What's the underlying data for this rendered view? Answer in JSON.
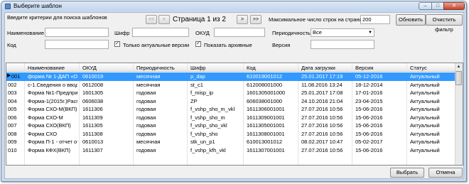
{
  "window": {
    "title": "Выберите шаблон",
    "min": "–",
    "max": "□",
    "close": "✕"
  },
  "toolbar": {
    "hint": "Введите критерии для поиска шаблонов",
    "first": "<<",
    "prev": "<",
    "page": "Страница 1 из 2",
    "next": ">",
    "last": ">>",
    "max_rows_label": "Максимальное число строк на странице",
    "max_rows_value": "200",
    "refresh": "Обновить",
    "clear_filter": "Очистить фильтр"
  },
  "filters": {
    "name_label": "Наименование",
    "cipher_label": "Шифр",
    "okud_label": "ОКУД",
    "period_label": "Периодичность",
    "period_value": "Все",
    "code_label": "Код",
    "only_actual_label": "Только актуальные версии",
    "show_archived_label": "Показать архивные",
    "version_label": "Версия"
  },
  "table": {
    "columns": [
      "Наименование",
      "ОКУД",
      "Периодичность",
      "Шифр",
      "Код",
      "Дата загрузки",
      "Версия",
      "Статус"
    ],
    "rows": [
      {
        "n": "001",
        "name": "форма № 1-ДАП «Об...",
        "okud": "0610019",
        "period": "месячная",
        "cipher": "p_dap",
        "code": "610019001012",
        "date": "25.01.2017 17:19",
        "version": "05-12-2016",
        "status": "Актуальный"
      },
      {
        "n": "002",
        "name": "с-1.Сведения о вводе...",
        "okud": "0612008",
        "period": "месячная",
        "cipher": "st_c1",
        "code": "612008001000",
        "date": "11.08.2016 13:24",
        "version": "18-12-2014",
        "status": "Актуальный"
      },
      {
        "n": "003",
        "name": "Форма №1-Предприн...",
        "okud": "1601305",
        "period": "годовая",
        "cipher": "f_misp_ip",
        "code": "1601305001000",
        "date": "25.01.2017 17:08",
        "version": "17-01-2016",
        "status": "Актуальный"
      },
      {
        "n": "004",
        "name": "Форма-1(2015г.)Расп...",
        "okud": "0606038",
        "period": "годовая",
        "cipher": "ZP",
        "code": "606038001000",
        "date": "24.10.2016 21:04",
        "version": "23-04-2015",
        "status": "Актуальный"
      },
      {
        "n": "005",
        "name": "Форма СХО-М(ВКП)",
        "okud": "1611306",
        "period": "годовая",
        "cipher": "f_vshp_sho_m_vkl",
        "code": "1611306001001",
        "date": "27.07.2016 10:56",
        "version": "15-06-2016",
        "status": "Актуальный"
      },
      {
        "n": "006",
        "name": "Форма СХО-М",
        "okud": "1611309",
        "period": "годовая",
        "cipher": "f_vshp_sho_m",
        "code": "1611309001001",
        "date": "27.07.2016 10:56",
        "version": "15-06-2016",
        "status": "Актуальный"
      },
      {
        "n": "007",
        "name": "Форма СХО(ВКП)",
        "okud": "1611305",
        "period": "годовая",
        "cipher": "f_vshp_sho_vkl",
        "code": "1611305001001",
        "date": "27.07.2016 10:56",
        "version": "15-06-2016",
        "status": "Актуальный"
      },
      {
        "n": "008",
        "name": "Форма СХО",
        "okud": "1611308",
        "period": "годовая",
        "cipher": "f_vshp_sho",
        "code": "1611308001001",
        "date": "27.07.2016 10:56",
        "version": "15-06-2016",
        "status": "Актуальный"
      },
      {
        "n": "009",
        "name": "Форма П-1 - отчет от ...",
        "okud": "0610013",
        "period": "месячная",
        "cipher": "stk_un_p1",
        "code": "610013001012",
        "date": "08.02.2017 10:47",
        "version": "05-02-2017",
        "status": "Актуальный"
      },
      {
        "n": "010",
        "name": "Форма КФХ(ВКП)",
        "okud": "1611307",
        "period": "годовая",
        "cipher": "f_vshp_kfh_vkl",
        "code": "1611307001001",
        "date": "27.07.2016 10:56",
        "version": "15-06-2016",
        "status": "Актуальный"
      }
    ]
  },
  "footer": {
    "select": "Выбрать",
    "cancel": "Отмена"
  }
}
